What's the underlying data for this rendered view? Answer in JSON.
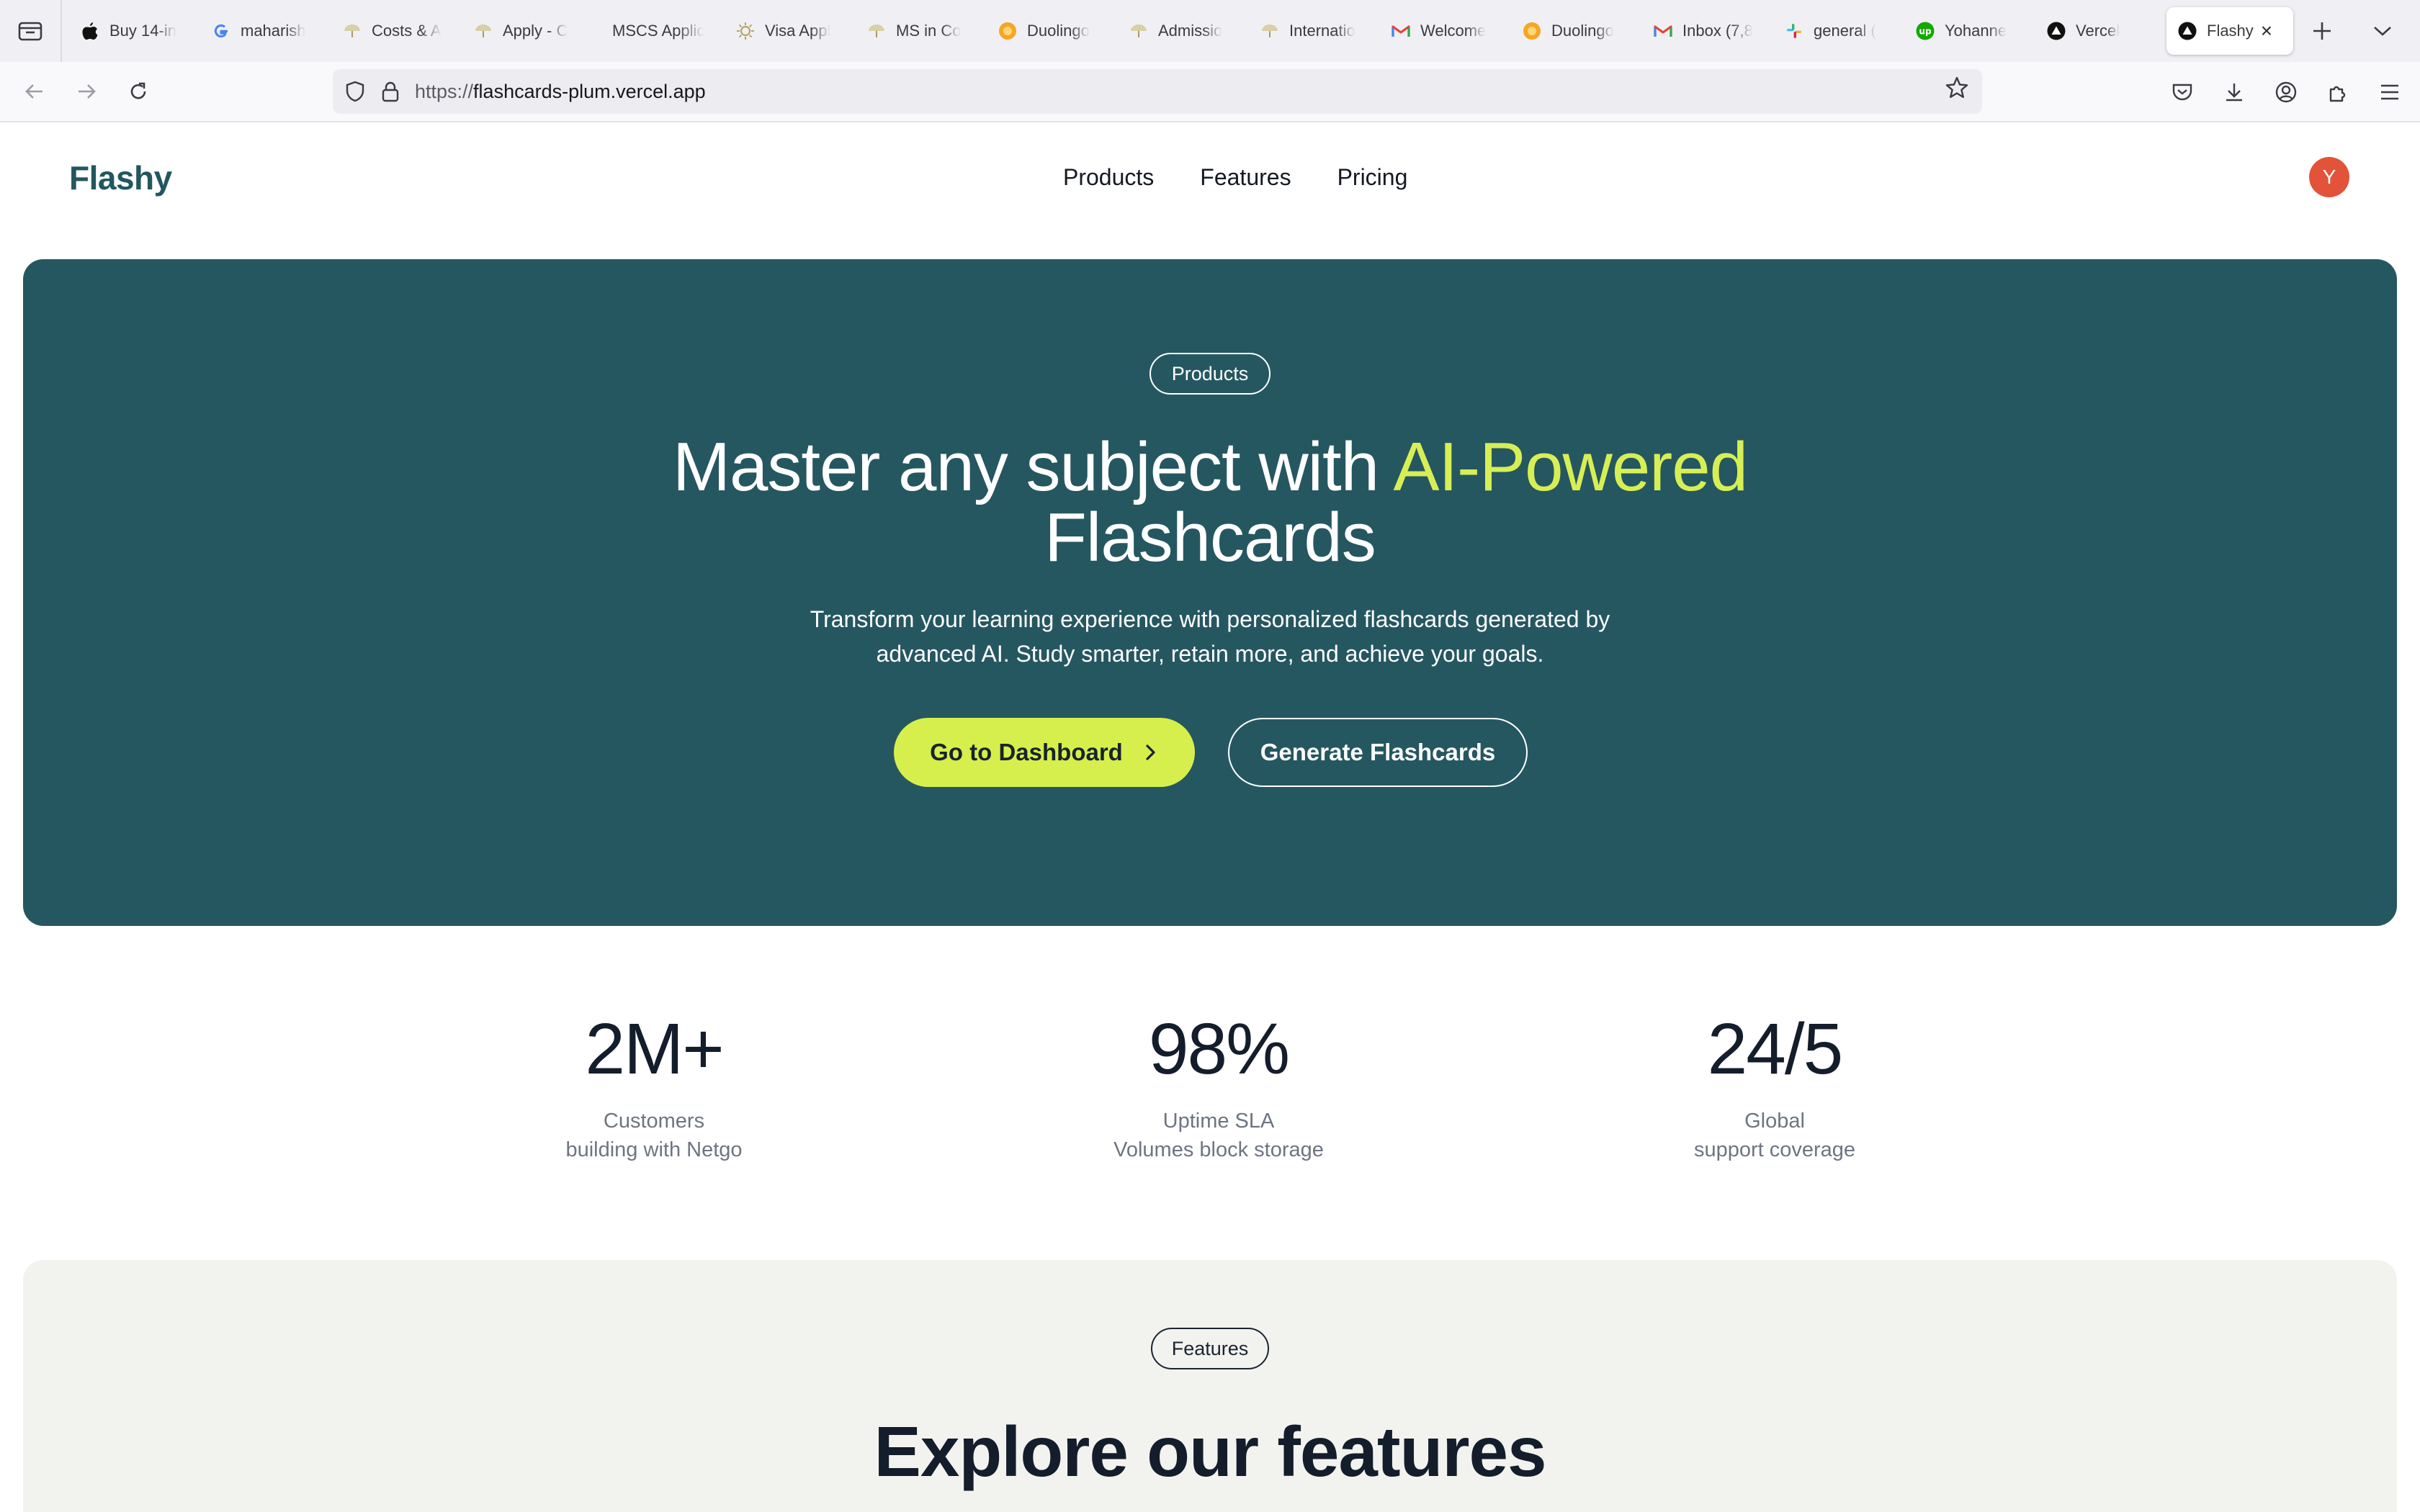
{
  "browser": {
    "tabs": [
      {
        "label": "Buy 14-in",
        "icon": "apple-icon"
      },
      {
        "label": "maharish",
        "icon": "google-icon"
      },
      {
        "label": "Costs & A",
        "icon": "umbrella-icon"
      },
      {
        "label": "Apply - C",
        "icon": "umbrella-icon"
      },
      {
        "label": "MSCS Applic",
        "icon": "none"
      },
      {
        "label": "Visa Appl",
        "icon": "sun-icon"
      },
      {
        "label": "MS in Co",
        "icon": "umbrella-icon"
      },
      {
        "label": "Duolingo",
        "icon": "duolingo-icon"
      },
      {
        "label": "Admissio",
        "icon": "umbrella-icon"
      },
      {
        "label": "Internatio",
        "icon": "umbrella-icon"
      },
      {
        "label": "Welcome",
        "icon": "gmail-icon"
      },
      {
        "label": "Duolingo",
        "icon": "duolingo-icon"
      },
      {
        "label": "Inbox (7,8",
        "icon": "gmail-icon"
      },
      {
        "label": "general (",
        "icon": "slack-icon"
      },
      {
        "label": "Yohanne",
        "icon": "upwork-icon"
      },
      {
        "label": "Vercel",
        "icon": "vercel-icon"
      }
    ],
    "active_tab": {
      "label": "Flashy",
      "icon": "vercel-icon"
    },
    "url": {
      "scheme": "https://",
      "host": "flashcards-plum.vercel.app"
    }
  },
  "site": {
    "logo": "Flashy",
    "nav": [
      "Products",
      "Features",
      "Pricing"
    ],
    "avatar_initial": "Y",
    "accent_color": "#d6ef4d",
    "brand_color": "#255761"
  },
  "hero": {
    "pill": "Products",
    "title_part1": "Master any subject with ",
    "title_accent": "AI-Powered",
    "title_part2": "Flashcards",
    "subtitle": "Transform your learning experience with personalized flashcards generated by advanced AI. Study smarter, retain more, and achieve your goals.",
    "primary_button": "Go to Dashboard",
    "secondary_button": "Generate Flashcards"
  },
  "stats": [
    {
      "value": "2M+",
      "line1": "Customers",
      "line2": "building with Netgo"
    },
    {
      "value": "98%",
      "line1": "Uptime SLA",
      "line2": "Volumes block storage"
    },
    {
      "value": "24/5",
      "line1": "Global",
      "line2": "support coverage"
    }
  ],
  "features": {
    "pill": "Features",
    "title": "Explore our features"
  }
}
